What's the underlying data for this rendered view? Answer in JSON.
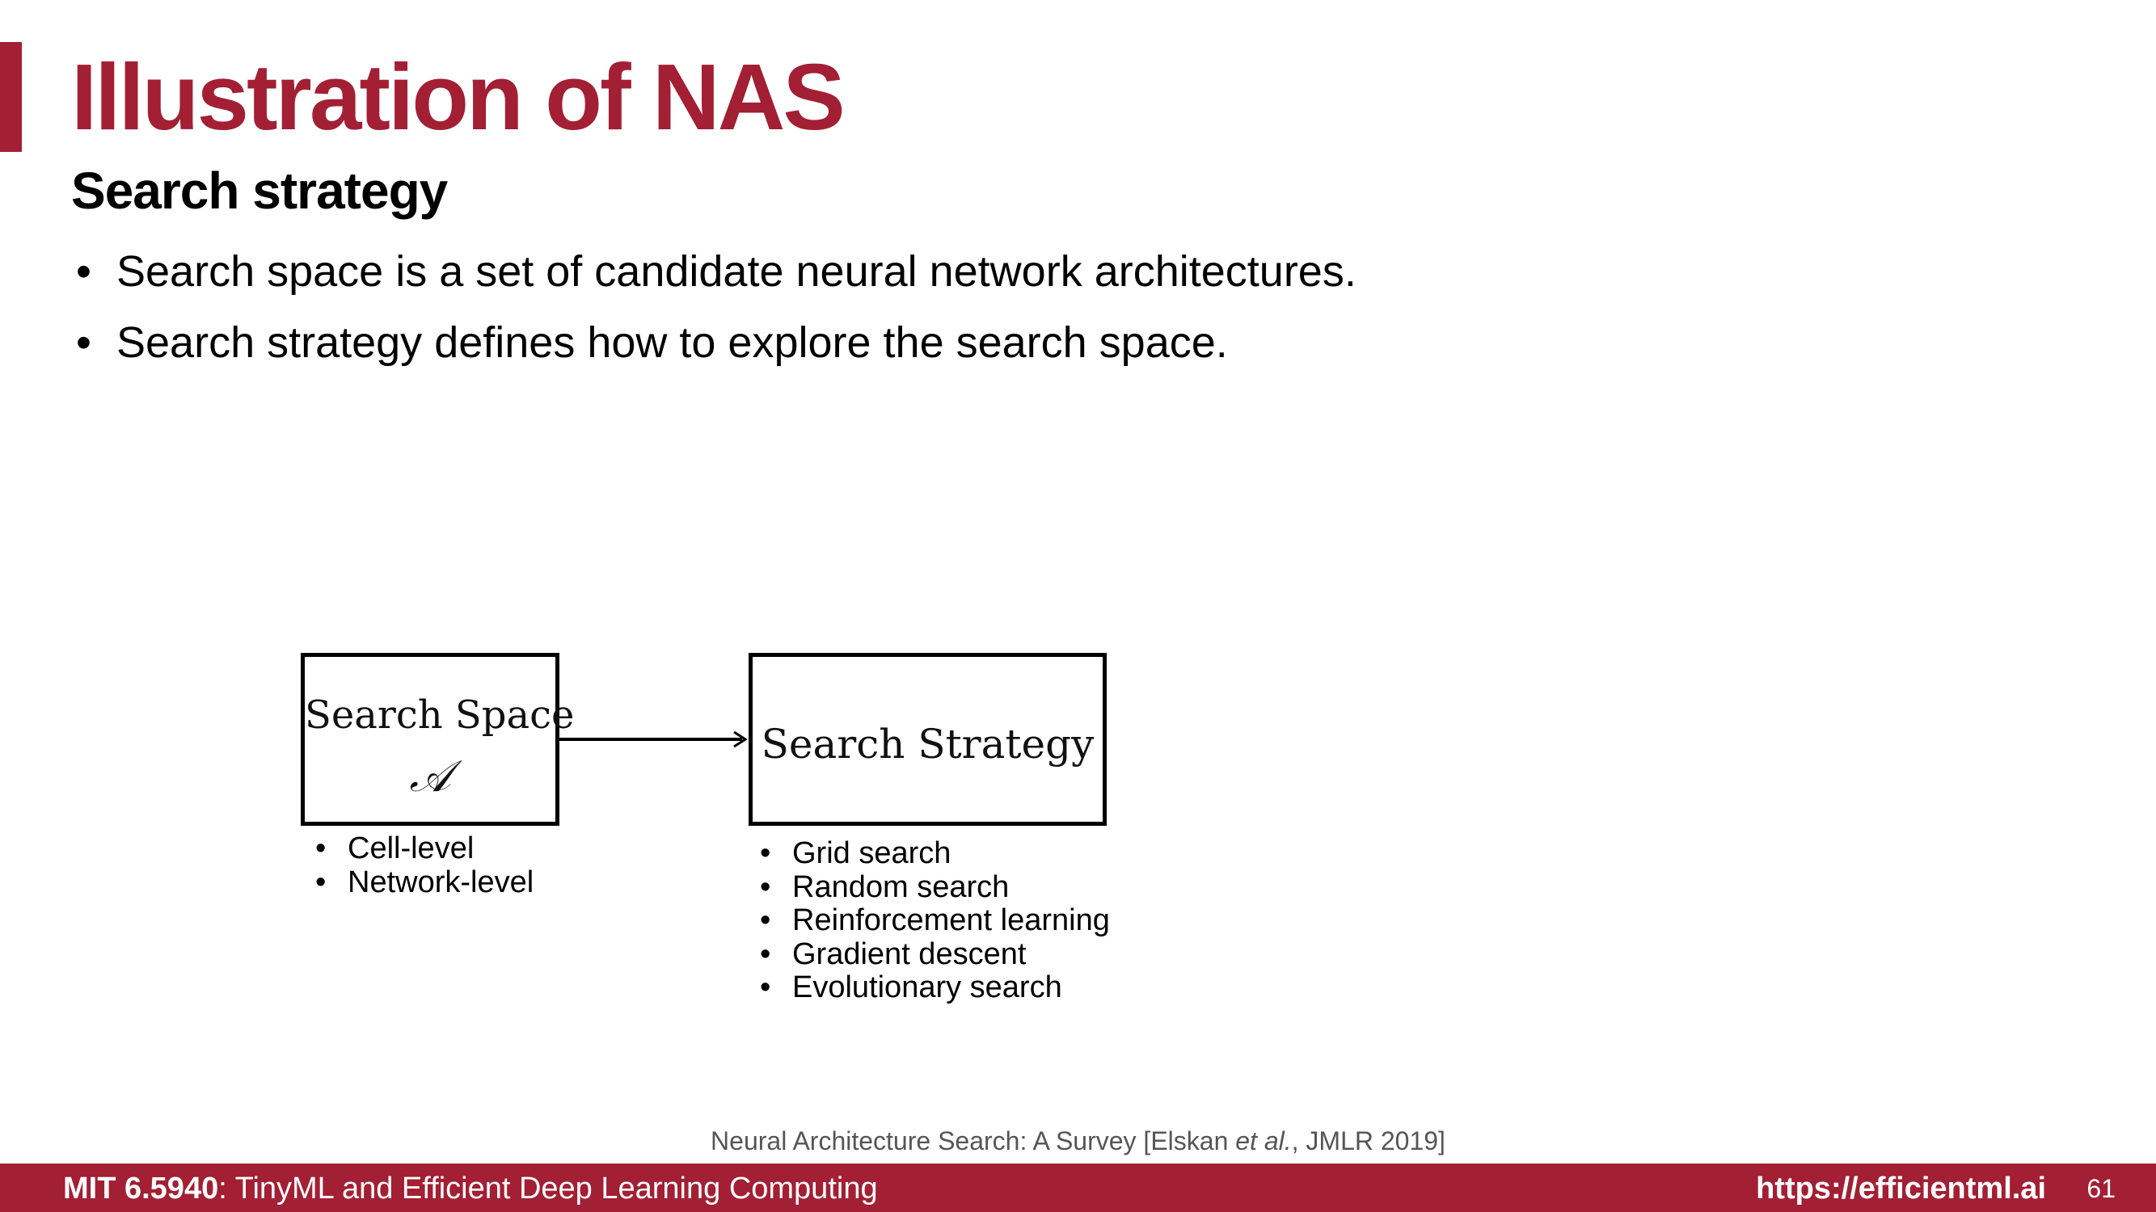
{
  "header": {
    "title": "Illustration of NAS",
    "subtitle": "Search strategy",
    "accent_color": "#a31f34"
  },
  "bullets": [
    {
      "marker": "•",
      "text": "Search space is a set of candidate neural network architectures."
    },
    {
      "marker": "•",
      "text": "Search strategy defines how to explore the search space."
    }
  ],
  "diagram": {
    "search_space_box": {
      "label": "Search Space",
      "symbol": "𝒜"
    },
    "search_strategy_box": {
      "label": "Search Strategy"
    },
    "arrow_direction": "search-space-to-search-strategy",
    "search_space_items": [
      {
        "marker": "•",
        "text": "Cell-level"
      },
      {
        "marker": "•",
        "text": "Network-level"
      }
    ],
    "search_strategy_items": [
      {
        "marker": "•",
        "text": "Grid search"
      },
      {
        "marker": "•",
        "text": "Random search"
      },
      {
        "marker": "•",
        "text": "Reinforcement learning"
      },
      {
        "marker": "•",
        "text": "Gradient descent"
      },
      {
        "marker": "•",
        "text": "Evolutionary search"
      }
    ]
  },
  "citation": {
    "prefix": "Neural Architecture Search: A Survey [Elskan ",
    "emphasis": "et al.",
    "suffix": ", JMLR 2019]"
  },
  "footer": {
    "course_code": "MIT 6.5940",
    "course_rest": ": TinyML and Efficient Deep Learning Computing",
    "url": "https://efficientml.ai",
    "page_number": "61"
  }
}
